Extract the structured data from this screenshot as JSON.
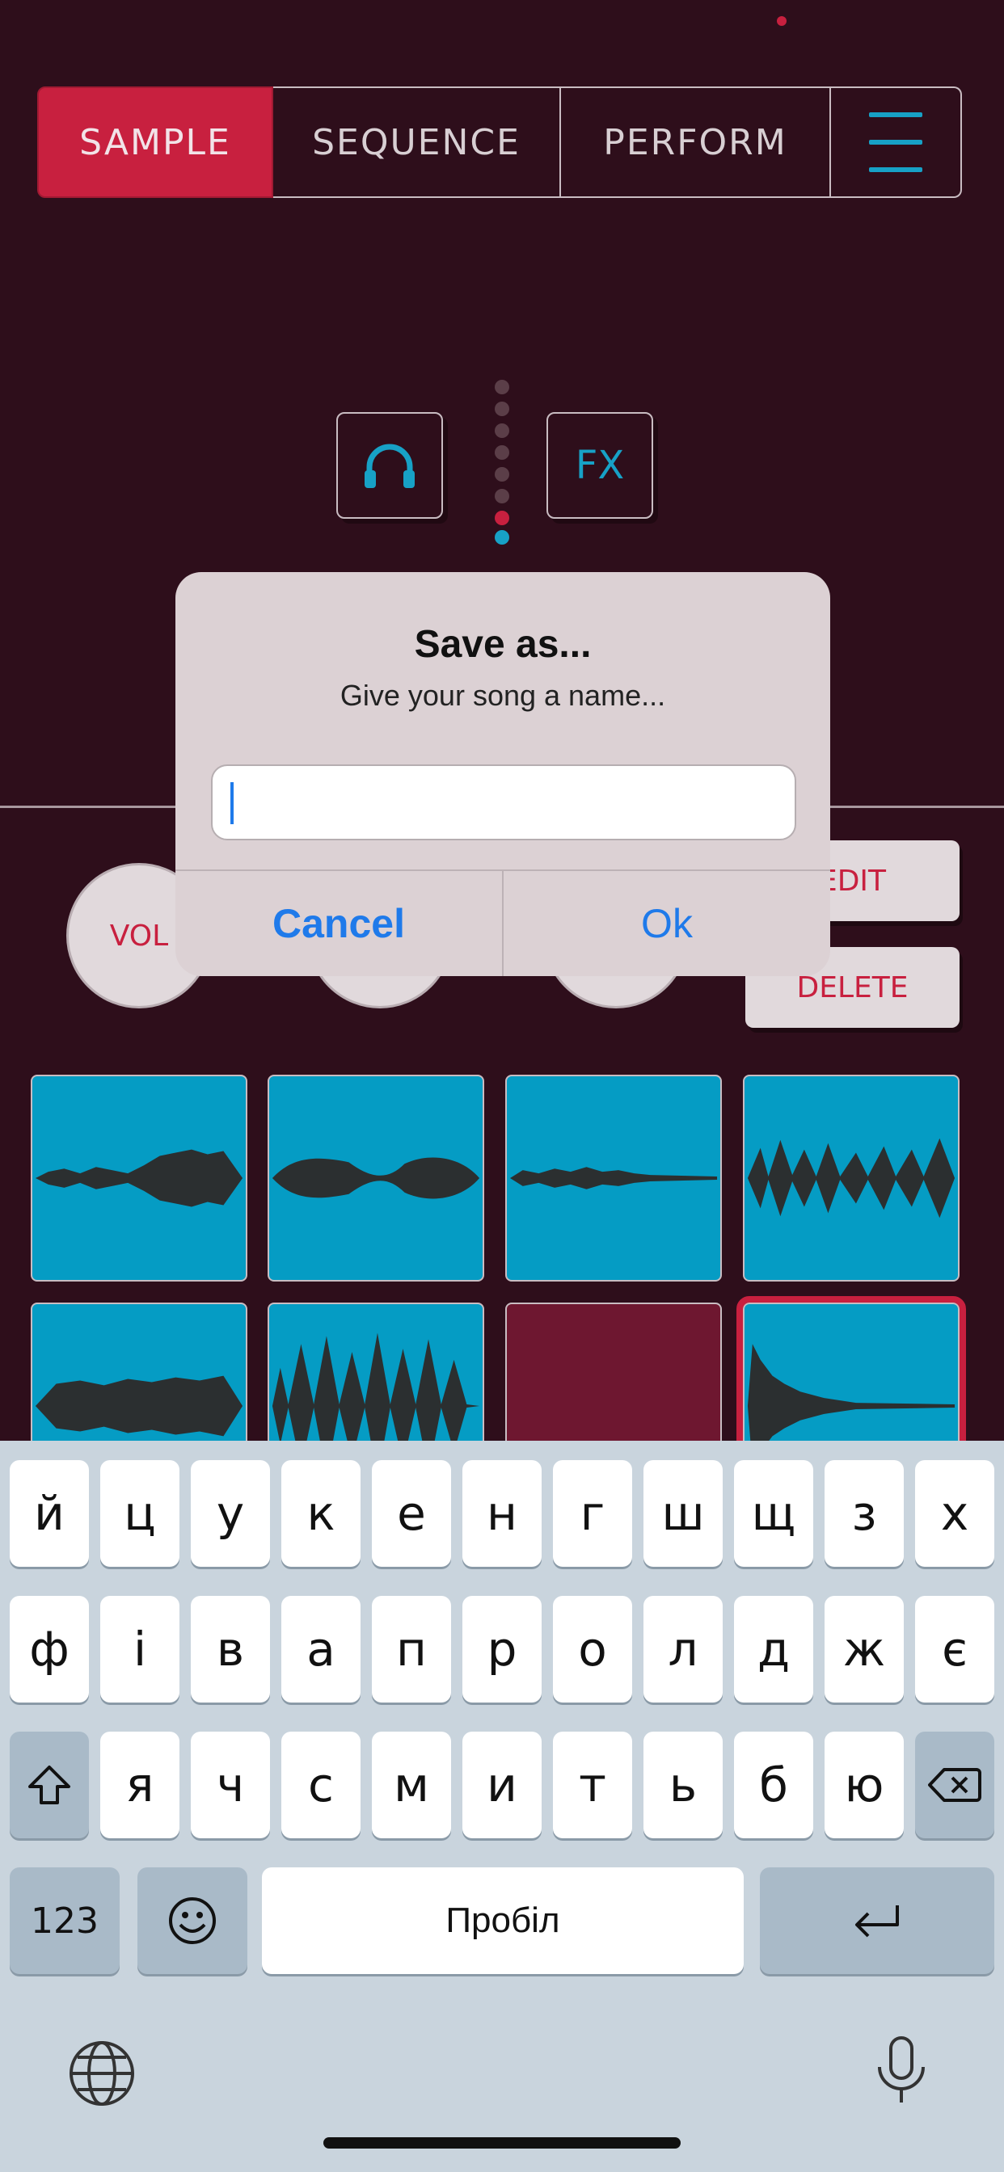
{
  "nav": {
    "tabs": [
      {
        "label": "SAMPLE",
        "active": true
      },
      {
        "label": "SEQUENCE",
        "active": false
      },
      {
        "label": "PERFORM",
        "active": false
      }
    ],
    "menu_icon": "hamburger-menu-icon"
  },
  "controls": {
    "headphones_icon": "headphones-icon",
    "fx_label": "FX",
    "meter_levels": 8,
    "meter_lit": 2
  },
  "knobs": {
    "vol_label": "VOL"
  },
  "side_buttons": {
    "edit_label": "EDIT",
    "delete_label": "DELETE"
  },
  "dialog": {
    "title": "Save as...",
    "message": "Give your song a name...",
    "input_value": "",
    "cancel_label": "Cancel",
    "ok_label": "Ok"
  },
  "keyboard": {
    "row1": [
      "й",
      "ц",
      "у",
      "к",
      "е",
      "н",
      "г",
      "ш",
      "щ",
      "з",
      "х"
    ],
    "row2": [
      "ф",
      "і",
      "в",
      "а",
      "п",
      "р",
      "о",
      "л",
      "д",
      "ж",
      "є"
    ],
    "row3": [
      "я",
      "ч",
      "с",
      "м",
      "и",
      "т",
      "ь",
      "б",
      "ю"
    ],
    "numbers_label": "123",
    "space_label": "Пробіл",
    "emoji_icon": "emoji-icon",
    "shift_icon": "shift-icon",
    "backspace_icon": "backspace-icon",
    "return_icon": "return-icon",
    "globe_icon": "globe-icon",
    "mic_icon": "microphone-icon"
  },
  "colors": {
    "background": "#2e0e1b",
    "accent_red": "#c8203f",
    "accent_blue": "#17a1c6",
    "pad_blue": "#059cc4",
    "ios_blue": "#1f7aea"
  }
}
